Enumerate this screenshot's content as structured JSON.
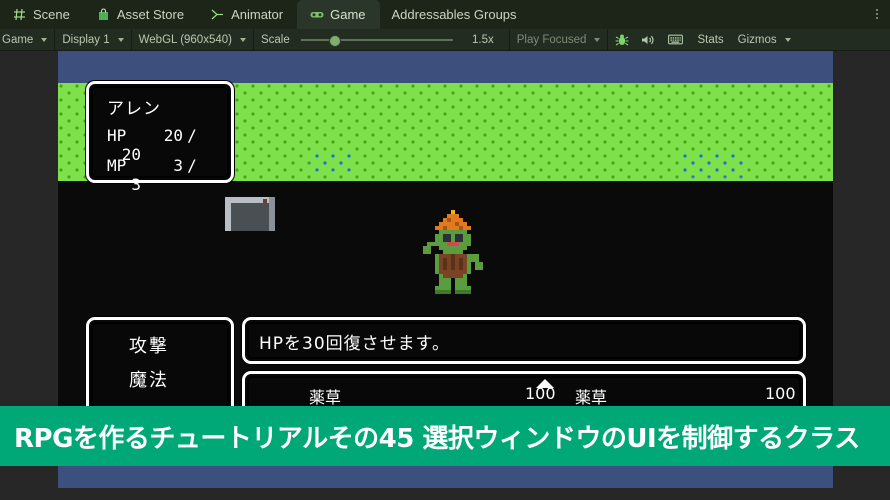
{
  "window": {
    "tabs": [
      {
        "label": "Scene",
        "icon": "grid-icon",
        "active": false
      },
      {
        "label": "Asset Store",
        "icon": "shopping-bag-icon",
        "active": false
      },
      {
        "label": "Animator",
        "icon": "animator-icon",
        "active": false
      },
      {
        "label": "Game",
        "icon": "gamepad-icon",
        "active": true
      },
      {
        "label": "Addressables Groups",
        "icon": "none",
        "active": false
      }
    ],
    "overflow_menu": "kebab-icon"
  },
  "toolbar": {
    "view_mode": "Game",
    "display": "Display 1",
    "aspect": "WebGL (960x540)",
    "scale_label": "Scale",
    "scale_value": "1.5x",
    "scale_percent": 18,
    "play_mode": "Play Focused",
    "icons": [
      {
        "name": "bug-icon",
        "label": ""
      },
      {
        "name": "mute-audio-icon",
        "label": ""
      },
      {
        "name": "render-doc-icon",
        "label": ""
      }
    ],
    "stats_label": "Stats",
    "gizmos_label": "Gizmos"
  },
  "game": {
    "status_window": {
      "name": "アレン",
      "rows": [
        {
          "label": "HP",
          "current": "20",
          "separator": "/",
          "max": "20"
        },
        {
          "label": "MP",
          "current": "3",
          "separator": "/",
          "max": "3"
        }
      ]
    },
    "command_window": {
      "items": [
        "攻撃",
        "魔法"
      ]
    },
    "description_window": {
      "text": "HPを30回復させます。"
    },
    "item_list_window": {
      "rows": [
        {
          "name": "薬草",
          "value": "100"
        },
        {
          "name": "薬草",
          "value": "100"
        }
      ],
      "cursor": "up-triangle-cursor"
    },
    "character_sprite": "goblin-character"
  },
  "banner": {
    "text": "RPGを作るチュートリアルその45 選択ウィンドウのUIを制御するクラス"
  },
  "colors": {
    "banner_bg": "#00a878",
    "sky": "#3c4f7d",
    "grass": "#7ee04a",
    "tab_active": "#2b362a",
    "toolbar_bg": "#232c20"
  }
}
